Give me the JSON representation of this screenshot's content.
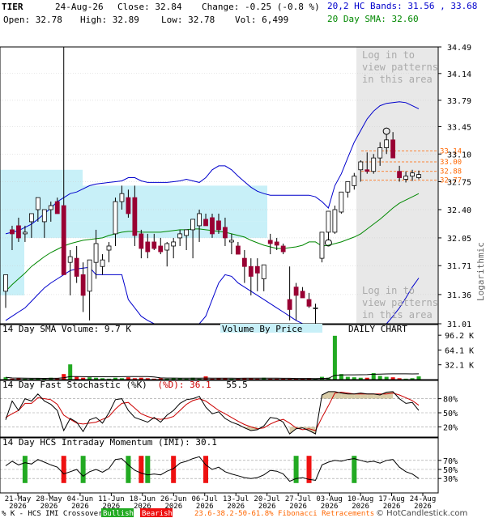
{
  "header": {
    "ticker": "TIER",
    "date": "24-Aug-26",
    "close_label": "Close: 32.84",
    "change_label": "Change: -0.25 (-0.8 %)",
    "open_label": "Open: 32.78",
    "high_label": "High: 32.89",
    "low_label": "Low: 32.78",
    "vol_label": "Vol: 6,499",
    "bands_label": "20,2 HC Bands: 31.56 , 33.68",
    "sma_label": "20 Day SMA: 32.60"
  },
  "colors": {
    "up": "#ffffff",
    "down": "#990033",
    "band": "#0000cc",
    "sma": "#008800",
    "vbp": "#c8f0f8",
    "shade": "#e8e8e8",
    "vol_up": "#22aa22",
    "vol_down": "#ee1111",
    "fib": "#ff6600",
    "pattern_text": "#aaaaaa"
  },
  "pattern_notice": [
    "Log in to",
    "view patterns",
    "in this area"
  ],
  "price_axis": {
    "scale": "logarithmic",
    "ylim": [
      31.01,
      34.49
    ],
    "ticks": [
      "34.49",
      "34.14",
      "33.79",
      "33.45",
      "33.10",
      "32.75",
      "32.40",
      "32.05",
      "31.71",
      "31.36",
      "31.01"
    ],
    "tick_values": [
      34.49,
      34.14,
      33.79,
      33.45,
      33.1,
      32.75,
      32.4,
      32.05,
      31.71,
      31.36,
      31.01
    ],
    "log_label": "Logarithmic"
  },
  "fib_levels": [
    {
      "label": "33.14",
      "value": 33.14
    },
    {
      "label": "33.00",
      "value": 33.0
    },
    {
      "label": "32.88",
      "value": 32.88
    },
    {
      "label": "32.77",
      "value": 32.77
    }
  ],
  "panels": {
    "volume": {
      "title": "14 Day SMA Volume: 9.7 K",
      "vbp_label": "Volume By Price",
      "daily_label": "DAILY CHART",
      "ticks": [
        "96.2 K",
        "64.1 K",
        "32.1 K"
      ],
      "tick_values": [
        96.2,
        64.1,
        32.1
      ]
    },
    "stoch": {
      "title_k": "14 Day Fast Stochastic (%K)",
      "title_d": "(%D): 36.1",
      "title_k_value": "55.5",
      "ticks": [
        "80%",
        "50%",
        "20%"
      ],
      "tick_values": [
        80,
        50,
        20
      ]
    },
    "imi": {
      "title": "14 Day HCS Intraday Momentum (IMI): 30.1",
      "ticks": [
        "70%",
        "50%",
        "30%"
      ],
      "tick_values": [
        70,
        50,
        30
      ]
    }
  },
  "x_axis": {
    "labels": [
      {
        "d": "21-May",
        "y": "2026"
      },
      {
        "d": "28-May",
        "y": "2026"
      },
      {
        "d": "04-Jun",
        "y": "2026"
      },
      {
        "d": "11-Jun",
        "y": "2026"
      },
      {
        "d": "18-Jun",
        "y": "2026"
      },
      {
        "d": "26-Jun",
        "y": "2026"
      },
      {
        "d": "06-Jul",
        "y": "2026"
      },
      {
        "d": "13-Jul",
        "y": "2026"
      },
      {
        "d": "20-Jul",
        "y": "2026"
      },
      {
        "d": "27-Jul",
        "y": "2026"
      },
      {
        "d": "03-Aug",
        "y": "2026"
      },
      {
        "d": "10-Aug",
        "y": "2026"
      },
      {
        "d": "17-Aug",
        "y": "2026"
      },
      {
        "d": "24-Aug",
        "y": "2026"
      }
    ]
  },
  "footer": {
    "legend_prefix": "% K - HCS IMI Crossover,",
    "bullish": "Bullish",
    "bearish": "Bearish",
    "fib_note": "23.6-38.2-50-61.8% Fibonacci Retracements",
    "copyright": "© HotCandlestick.com"
  },
  "chart_data": {
    "type": "candlestick",
    "title": "TIER",
    "y_scale": "log",
    "ylim": [
      31.01,
      34.49
    ],
    "dates": [
      "21-May",
      "22-May",
      "26-May",
      "27-May",
      "28-May",
      "29-May",
      "01-Jun",
      "02-Jun",
      "03-Jun",
      "04-Jun",
      "05-Jun",
      "08-Jun",
      "09-Jun",
      "10-Jun",
      "11-Jun",
      "12-Jun",
      "15-Jun",
      "16-Jun",
      "17-Jun",
      "18-Jun",
      "22-Jun",
      "23-Jun",
      "24-Jun",
      "25-Jun",
      "26-Jun",
      "29-Jun",
      "30-Jun",
      "01-Jul",
      "02-Jul",
      "06-Jul",
      "07-Jul",
      "08-Jul",
      "09-Jul",
      "10-Jul",
      "13-Jul",
      "14-Jul",
      "15-Jul",
      "16-Jul",
      "17-Jul",
      "20-Jul",
      "21-Jul",
      "22-Jul",
      "23-Jul",
      "24-Jul",
      "27-Jul",
      "28-Jul",
      "29-Jul",
      "30-Jul",
      "31-Jul",
      "03-Aug",
      "04-Aug",
      "05-Aug",
      "06-Aug",
      "07-Aug",
      "10-Aug",
      "11-Aug",
      "12-Aug",
      "13-Aug",
      "14-Aug",
      "17-Aug",
      "18-Aug",
      "19-Aug",
      "20-Aug",
      "21-Aug",
      "24-Aug"
    ],
    "open": [
      31.4,
      32.15,
      32.2,
      32.1,
      32.25,
      32.4,
      32.25,
      32.4,
      32.5,
      32.45,
      31.75,
      31.8,
      31.6,
      31.4,
      31.75,
      31.7,
      31.9,
      32.1,
      32.5,
      32.55,
      32.55,
      32.1,
      32.0,
      32.0,
      31.95,
      31.9,
      31.95,
      32.05,
      32.08,
      32.15,
      32.2,
      32.28,
      32.3,
      32.26,
      32.18,
      32.0,
      31.95,
      31.8,
      31.7,
      31.7,
      31.55,
      32.02,
      32.0,
      31.95,
      31.3,
      31.45,
      31.4,
      31.3,
      31.2,
      31.8,
      32.12,
      32.12,
      32.37,
      32.62,
      32.7,
      32.9,
      32.9,
      32.88,
      33.05,
      33.18,
      33.28,
      32.88,
      32.78,
      32.82,
      32.8
    ],
    "high": [
      31.6,
      32.2,
      32.3,
      32.2,
      32.3,
      32.45,
      32.35,
      32.5,
      32.55,
      34.49,
      31.9,
      31.95,
      31.75,
      31.65,
      32.15,
      31.85,
      32.0,
      32.55,
      32.7,
      32.65,
      32.7,
      32.15,
      32.1,
      32.1,
      32.05,
      32.0,
      32.05,
      32.15,
      32.15,
      32.22,
      32.4,
      32.35,
      32.35,
      32.35,
      32.3,
      32.1,
      32.0,
      31.9,
      31.8,
      31.8,
      31.65,
      32.1,
      32.05,
      31.98,
      31.7,
      31.5,
      31.45,
      31.38,
      31.25,
      31.92,
      32.2,
      32.45,
      32.5,
      32.75,
      32.86,
      33.02,
      33.12,
      33.1,
      33.25,
      33.35,
      33.38,
      32.95,
      32.88,
      32.9,
      32.89
    ],
    "low": [
      31.2,
      31.9,
      32.0,
      32.0,
      32.05,
      32.25,
      32.05,
      32.25,
      32.35,
      31.6,
      31.35,
      31.5,
      31.15,
      31.05,
      31.55,
      31.6,
      31.75,
      31.95,
      32.4,
      32.3,
      31.95,
      31.8,
      31.8,
      31.9,
      31.85,
      31.7,
      31.8,
      31.95,
      31.9,
      31.8,
      32.0,
      32.2,
      32.05,
      32.1,
      31.95,
      31.85,
      31.85,
      31.5,
      31.35,
      31.4,
      31.4,
      31.85,
      31.9,
      31.85,
      31.05,
      31.05,
      31.35,
      31.2,
      31.01,
      31.75,
      32.02,
      32.1,
      32.35,
      32.55,
      32.65,
      32.75,
      32.85,
      32.85,
      32.95,
      33.1,
      33.05,
      32.75,
      32.74,
      32.76,
      32.78
    ],
    "close": [
      31.6,
      32.1,
      32.05,
      32.12,
      32.35,
      32.55,
      32.4,
      32.45,
      32.35,
      31.6,
      31.82,
      31.58,
      31.35,
      31.78,
      31.98,
      31.78,
      31.95,
      32.5,
      32.6,
      32.35,
      32.08,
      31.92,
      31.88,
      31.92,
      31.88,
      31.98,
      32.0,
      32.1,
      32.15,
      32.28,
      32.35,
      32.2,
      32.1,
      32.15,
      32.05,
      32.02,
      31.85,
      31.7,
      31.58,
      31.62,
      31.72,
      31.98,
      31.96,
      31.88,
      31.18,
      31.35,
      31.32,
      31.22,
      31.2,
      32.12,
      32.38,
      32.4,
      32.62,
      32.75,
      32.82,
      33.0,
      32.88,
      33.05,
      33.18,
      33.28,
      33.05,
      32.8,
      32.82,
      32.86,
      32.84
    ],
    "series": [
      {
        "name": "20,2 HC Bands",
        "values_upper": [
          32.1,
          32.12,
          32.14,
          32.18,
          32.22,
          32.28,
          32.35,
          32.42,
          32.5,
          32.55,
          32.6,
          32.62,
          32.66,
          32.7,
          32.72,
          32.73,
          32.74,
          32.75,
          32.76,
          32.8,
          32.8,
          32.76,
          32.74,
          32.74,
          32.74,
          32.74,
          32.75,
          32.76,
          32.78,
          32.76,
          32.74,
          32.8,
          32.9,
          32.95,
          32.95,
          32.9,
          32.82,
          32.75,
          32.68,
          32.63,
          32.6,
          32.58,
          32.58,
          32.58,
          32.58,
          32.58,
          32.58,
          32.58,
          32.56,
          32.5,
          32.42,
          32.7,
          32.85,
          33.05,
          33.25,
          33.4,
          33.55,
          33.65,
          33.72,
          33.75,
          33.76,
          33.77,
          33.76,
          33.72,
          33.68
        ],
        "values_lower": [
          31.05,
          31.1,
          31.15,
          31.2,
          31.28,
          31.36,
          31.44,
          31.5,
          31.55,
          31.6,
          31.65,
          31.67,
          31.68,
          31.69,
          31.6,
          31.6,
          31.6,
          31.6,
          31.6,
          31.3,
          31.2,
          31.1,
          31.05,
          31.01,
          31.01,
          31.01,
          31.01,
          31.01,
          31.01,
          31.01,
          31.01,
          31.1,
          31.3,
          31.5,
          31.6,
          31.58,
          31.5,
          31.45,
          31.4,
          31.35,
          31.3,
          31.25,
          31.2,
          31.15,
          31.1,
          31.05,
          31.01,
          31.01,
          31.01,
          31.01,
          31.01,
          31.01,
          31.01,
          31.01,
          31.01,
          31.01,
          31.01,
          31.01,
          31.01,
          31.01,
          31.1,
          31.2,
          31.32,
          31.45,
          31.56
        ]
      },
      {
        "name": "20 Day SMA",
        "values": [
          31.4,
          31.48,
          31.55,
          31.62,
          31.7,
          31.76,
          31.82,
          31.87,
          31.91,
          31.95,
          31.98,
          32.0,
          32.02,
          32.03,
          32.04,
          32.05,
          32.08,
          32.1,
          32.12,
          32.13,
          32.13,
          32.12,
          32.12,
          32.12,
          32.12,
          32.13,
          32.14,
          32.15,
          32.15,
          32.16,
          32.16,
          32.15,
          32.14,
          32.13,
          32.12,
          32.1,
          32.08,
          32.06,
          32.02,
          31.99,
          31.96,
          31.94,
          31.92,
          31.92,
          31.93,
          31.94,
          31.96,
          32.0,
          32.0,
          31.95,
          31.96,
          31.98,
          32.0,
          32.03,
          32.06,
          32.1,
          32.16,
          32.22,
          32.28,
          32.35,
          32.42,
          32.48,
          32.52,
          32.56,
          32.6
        ]
      }
    ],
    "volume_k": [
      5,
      2,
      3,
      2,
      2,
      3,
      2,
      4,
      3,
      12,
      33,
      6,
      4,
      5,
      4,
      3,
      2,
      4,
      3,
      5,
      3,
      4,
      3,
      2,
      3,
      2,
      3,
      3,
      2,
      4,
      2,
      7,
      2,
      3,
      3,
      2,
      2,
      3,
      3,
      2,
      4,
      2,
      2,
      2,
      2,
      2,
      2,
      3,
      2,
      6,
      4,
      95,
      12,
      6,
      5,
      4,
      4,
      14,
      8,
      6,
      5,
      3,
      2,
      3,
      7
    ],
    "stoch_k": [
      35,
      75,
      55,
      80,
      75,
      90,
      75,
      68,
      55,
      12,
      38,
      30,
      10,
      35,
      40,
      28,
      50,
      78,
      80,
      55,
      40,
      35,
      30,
      40,
      30,
      45,
      55,
      70,
      78,
      80,
      85,
      62,
      48,
      52,
      38,
      30,
      25,
      18,
      12,
      14,
      22,
      40,
      38,
      30,
      5,
      16,
      18,
      12,
      5,
      88,
      95,
      95,
      92,
      90,
      90,
      92,
      90,
      90,
      88,
      94,
      95,
      80,
      70,
      72,
      55
    ],
    "stoch_d": [
      40,
      48,
      55,
      70,
      70,
      82,
      80,
      78,
      68,
      45,
      36,
      28,
      26,
      28,
      30,
      36,
      42,
      58,
      70,
      72,
      60,
      48,
      42,
      38,
      36,
      38,
      42,
      55,
      68,
      76,
      80,
      75,
      65,
      55,
      48,
      40,
      32,
      25,
      20,
      16,
      18,
      26,
      32,
      36,
      28,
      18,
      14,
      16,
      12,
      40,
      65,
      92,
      94,
      92,
      90,
      90,
      90,
      90,
      90,
      90,
      92,
      88,
      82,
      76,
      66
    ],
    "imi": [
      58,
      68,
      60,
      65,
      62,
      72,
      66,
      60,
      55,
      40,
      45,
      50,
      35,
      45,
      50,
      44,
      52,
      72,
      74,
      60,
      48,
      42,
      38,
      40,
      38,
      46,
      52,
      64,
      68,
      74,
      78,
      60,
      50,
      55,
      45,
      40,
      36,
      32,
      30,
      32,
      38,
      48,
      46,
      40,
      24,
      30,
      32,
      28,
      26,
      60,
      66,
      70,
      68,
      72,
      74,
      70,
      66,
      68,
      64,
      70,
      72,
      55,
      45,
      40,
      30
    ],
    "crossovers": [
      {
        "i": 3,
        "type": "bullish"
      },
      {
        "i": 9,
        "type": "bearish"
      },
      {
        "i": 12,
        "type": "bullish"
      },
      {
        "i": 19,
        "type": "bullish"
      },
      {
        "i": 21,
        "type": "bearish"
      },
      {
        "i": 22,
        "type": "bullish"
      },
      {
        "i": 26,
        "type": "bearish"
      },
      {
        "i": 31,
        "type": "bearish"
      },
      {
        "i": 45,
        "type": "bullish"
      },
      {
        "i": 47,
        "type": "bearish"
      },
      {
        "i": 54,
        "type": "bullish"
      }
    ],
    "vbp_zones": [
      {
        "lo": 31.35,
        "hi": 32.6,
        "strength": 0.05
      },
      {
        "lo": 32.6,
        "hi": 32.9,
        "strength": 0.17
      },
      {
        "lo": 32.25,
        "hi": 32.7,
        "strength": 0.55
      },
      {
        "lo": 32.05,
        "hi": 32.25,
        "strength": 0.55
      }
    ]
  }
}
